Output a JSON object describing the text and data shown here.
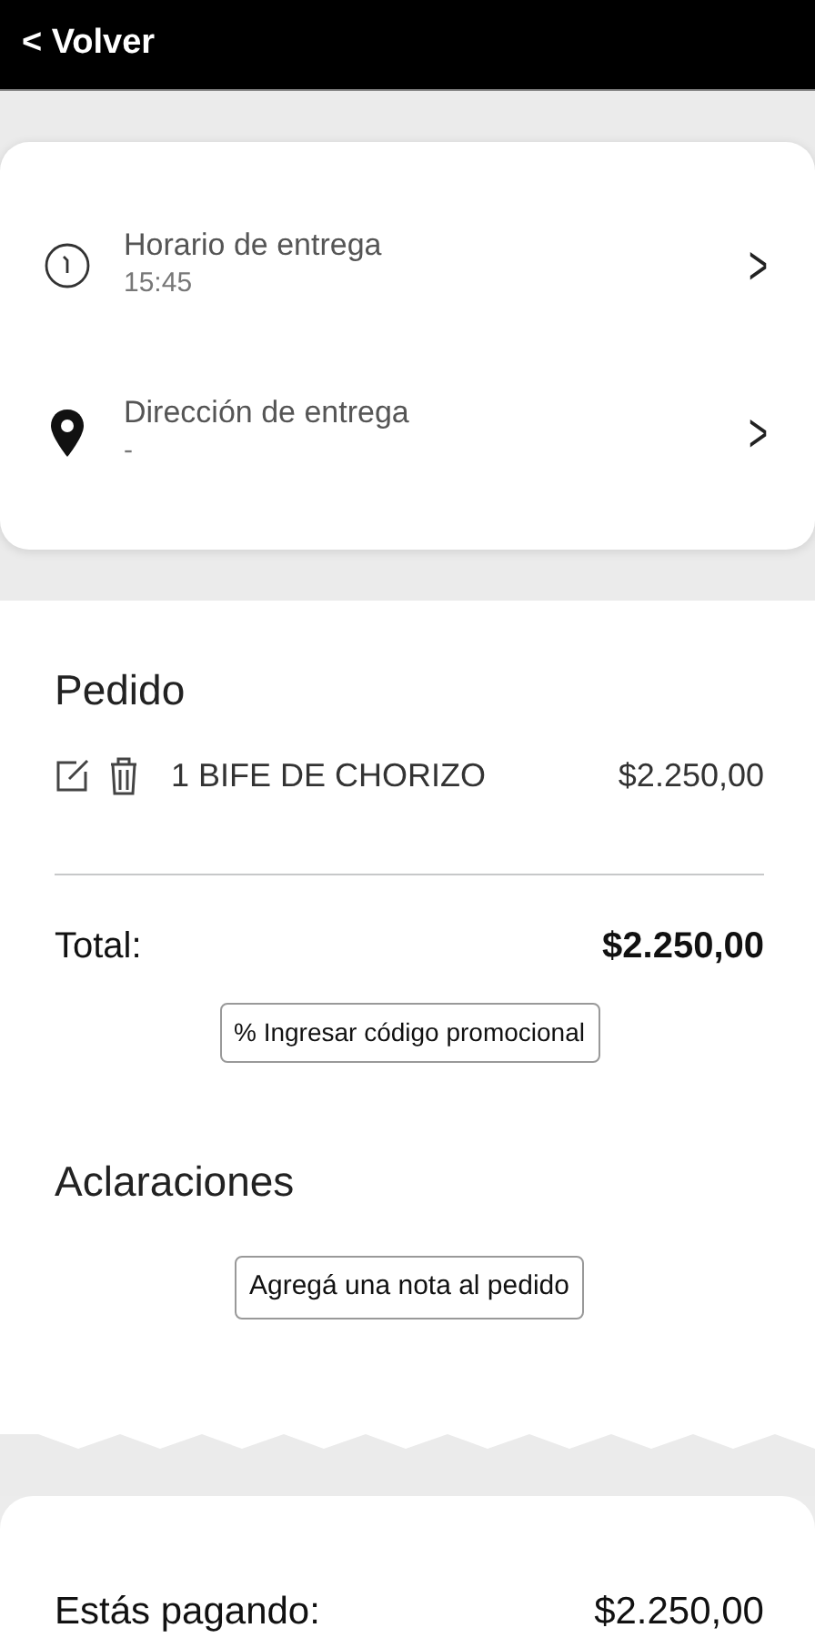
{
  "header": {
    "back_icon": "<",
    "back_label": "Volver"
  },
  "delivery": [
    {
      "kind": "time",
      "label": "Horario de entrega",
      "value": "15:45",
      "chevron": ">"
    },
    {
      "kind": "address",
      "label": "Dirección de entrega",
      "value": "-",
      "chevron": ">"
    }
  ],
  "order": {
    "title": "Pedido",
    "items": [
      {
        "qty": "1",
        "name": "BIFE DE CHORIZO",
        "price": "$2.250,00"
      }
    ],
    "total_label": "Total:",
    "total": "$2.250,00",
    "promo_button": "% Ingresar código promocional"
  },
  "notes": {
    "title": "Aclaraciones",
    "button": "Agregá una nota al pedido"
  },
  "payment": {
    "label": "Estás pagando:",
    "amount": "$2.250,00"
  }
}
